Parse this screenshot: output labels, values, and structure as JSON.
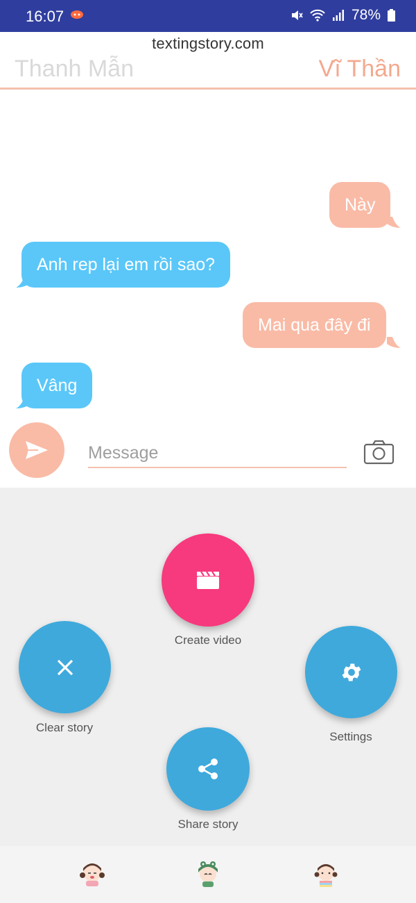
{
  "status": {
    "time": "16:07",
    "battery": "78%"
  },
  "header": {
    "site": "textingstory.com",
    "left_name": "Thanh Mẫn",
    "right_name": "Vĩ Thần"
  },
  "messages": [
    {
      "side": "right",
      "text": "Này"
    },
    {
      "side": "left",
      "text": "Anh rep lại em rồi sao?"
    },
    {
      "side": "right",
      "text": "Mai qua đây đi"
    },
    {
      "side": "left",
      "text": "Vâng"
    }
  ],
  "composer": {
    "placeholder": "Message"
  },
  "actions": {
    "create_video": "Create video",
    "clear_story": "Clear story",
    "settings": "Settings",
    "share_story": "Share story"
  },
  "colors": {
    "status_bar": "#2f3e9e",
    "right_bubble": "#f9bba6",
    "left_bubble": "#5ac7f8",
    "create_video_fab": "#f7397d",
    "action_fab": "#3fa9dc"
  },
  "icons": {
    "send": "send-icon",
    "camera": "camera-icon",
    "video": "clapperboard-icon",
    "close": "close-icon",
    "settings": "gear-icon",
    "share": "share-icon"
  }
}
